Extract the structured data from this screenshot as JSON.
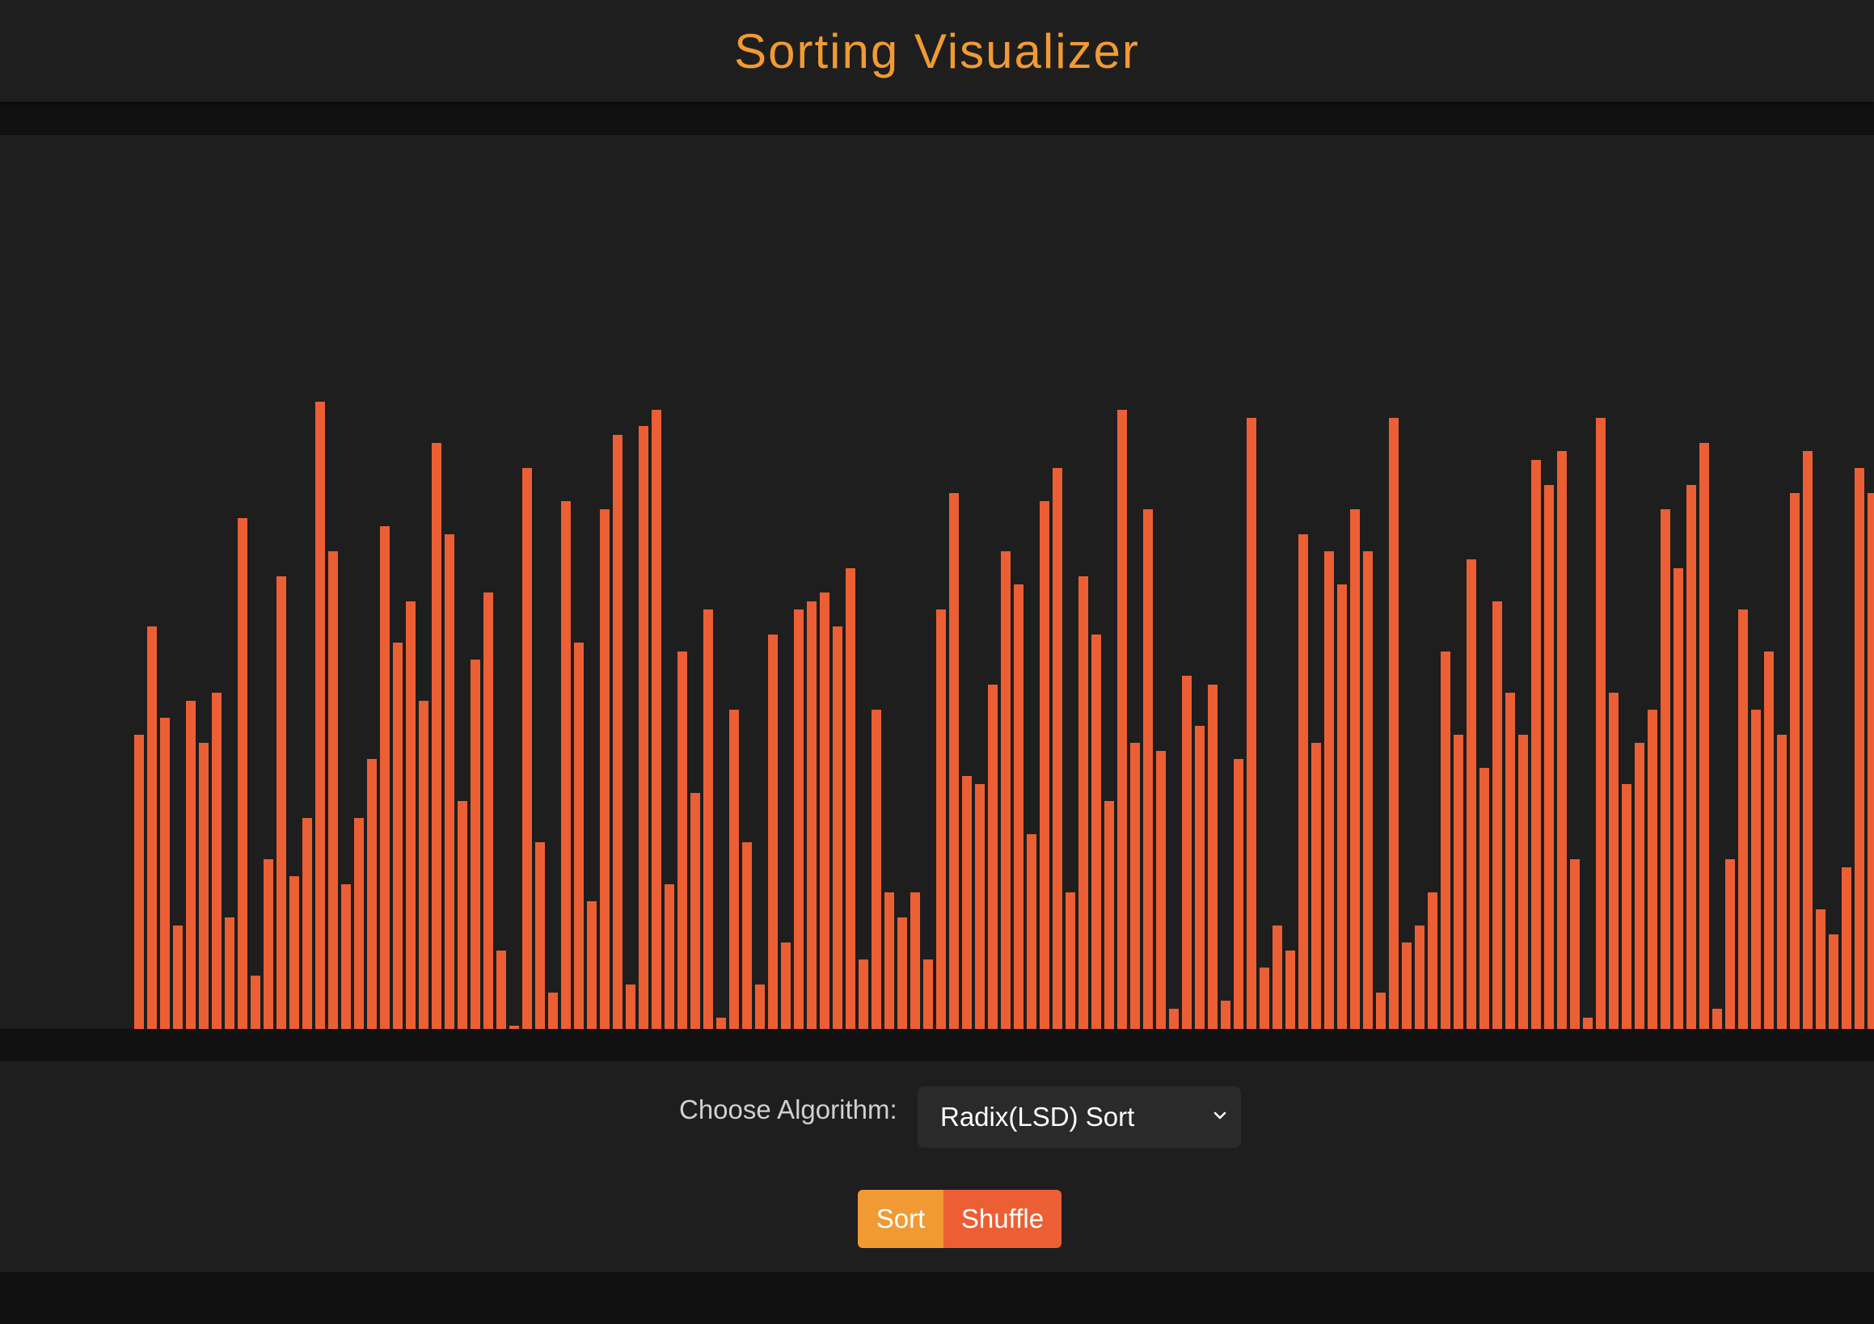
{
  "app": {
    "title": "Sorting Visualizer"
  },
  "colors": {
    "accent": "#f19a34",
    "bar": "#ec5f34",
    "sort_button": "#f19a34",
    "shuffle_button": "#ec5f34",
    "panel": "#1e1e1e",
    "background": "#111111"
  },
  "visualizer": {
    "bar_values": [
      35,
      48,
      37,
      12,
      39,
      34,
      40,
      13,
      61,
      6,
      20,
      54,
      18,
      25,
      75,
      57,
      17,
      25,
      32,
      60,
      46,
      51,
      39,
      70,
      59,
      27,
      44,
      52,
      9,
      0,
      67,
      22,
      4,
      63,
      46,
      15,
      62,
      71,
      5,
      72,
      74,
      17,
      45,
      28,
      50,
      1,
      38,
      22,
      5,
      47,
      10,
      50,
      51,
      52,
      48,
      55,
      8,
      38,
      16,
      13,
      16,
      8,
      50,
      64,
      30,
      29,
      41,
      57,
      53,
      23,
      63,
      67,
      16,
      54,
      47,
      27,
      74,
      34,
      62,
      33,
      2,
      42,
      36,
      41,
      3,
      32,
      73,
      7,
      12,
      9,
      59,
      34,
      57,
      53,
      62,
      57,
      4,
      73,
      10,
      12,
      16,
      45,
      35,
      56,
      31,
      51,
      40,
      35,
      68,
      65,
      69,
      20,
      1,
      73,
      40,
      29,
      34,
      38,
      62,
      55,
      65,
      70,
      2,
      20,
      50,
      38,
      45,
      35,
      64,
      69,
      14,
      11,
      19,
      67,
      64
    ]
  },
  "controls": {
    "algorithm_label": "Choose Algorithm:",
    "algorithm_selected": "Radix(LSD) Sort",
    "sort_label": "Sort",
    "shuffle_label": "Shuffle"
  }
}
